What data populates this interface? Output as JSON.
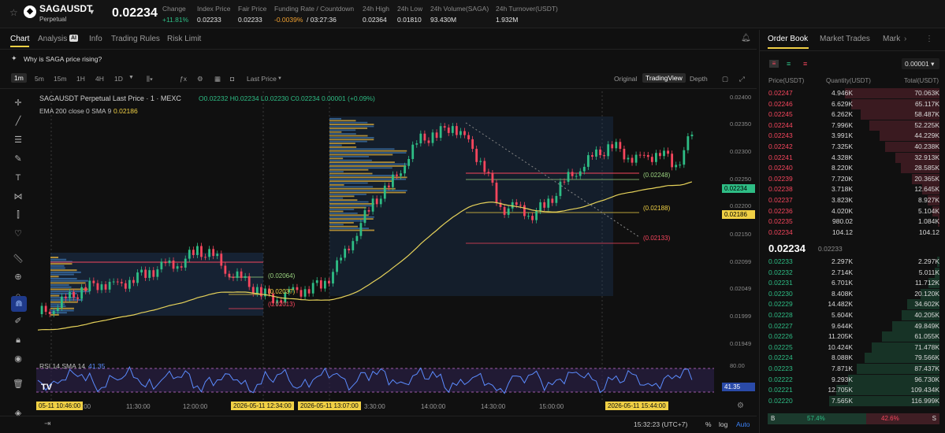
{
  "header": {
    "symbol": "SAGAUSDT",
    "subtitle": "Perpetual",
    "last_price": "0.02234",
    "stats": [
      {
        "label": "Change",
        "value": "+11.81%",
        "tone": "green"
      },
      {
        "label": "Index Price",
        "value": "0.02233",
        "tone": ""
      },
      {
        "label": "Fair Price",
        "value": "0.02233",
        "tone": ""
      },
      {
        "label": "Funding Rate / Countdown",
        "value": "-0.0039%",
        "value2": "/ 03:27:36",
        "tone": "orange"
      },
      {
        "label": "24h High",
        "value": "0.02364",
        "tone": ""
      },
      {
        "label": "24h Low",
        "value": "0.01810",
        "tone": ""
      },
      {
        "label": "24h Volume(SAGA)",
        "value": "93.430M",
        "tone": ""
      },
      {
        "label": "24h Turnover(USDT)",
        "value": "1.932M",
        "tone": ""
      }
    ]
  },
  "tabs": [
    "Chart",
    "Analysis",
    "Info",
    "Trading Rules",
    "Risk Limit"
  ],
  "analysis_badge": "AI",
  "banner": "Why is SAGA price rising?",
  "toolbar": {
    "intervals": [
      "1m",
      "5m",
      "15m",
      "1H",
      "4H",
      "1D"
    ],
    "price_type": "Last Price",
    "views": [
      "Original",
      "TradingView",
      "Depth"
    ]
  },
  "chart_info": {
    "title": "SAGAUSDT Perpetual Last Price · 1 · MEXC",
    "ohlc": "O0.02232  H0.02234  L0.02230  C0.02234  0.00001 (+0.09%)",
    "ema_label": "EMA 200 close 0 SMA 9",
    "ema_value": "0.02186",
    "rsi_label": "RSI 14 SMA 14",
    "rsi_value": "41.35",
    "rsi_badge": "41.35",
    "rsi_upper": "80.00",
    "level_labels": [
      "(0.02248)",
      "(0.02188)",
      "(0.02133)",
      "(0.02064)",
      "(0.02037)",
      "(0.02013)"
    ],
    "price_badge": "0.02234",
    "ema_badge": "0.02186"
  },
  "chart_data": {
    "type": "line",
    "y_ticks": [
      "0.02400",
      "0.02350",
      "0.02300",
      "0.02250",
      "0.02200",
      "0.02150",
      "0.02099",
      "0.02049",
      "0.01999",
      "0.01949"
    ],
    "x_ticks": [
      "11:30:00",
      "12:00:00",
      "3:30:00",
      "14:00:00",
      "14:30:00",
      "15:00:00"
    ],
    "highlighted_times": [
      "05-11  10:46:00",
      "2026-05-11  12:34:00",
      "2026-05-11  13:07:00",
      "2026-05-11  15:44:00"
    ],
    "ylim": [
      0.0193,
      0.0241
    ],
    "close": [
      0.02,
      0.02015,
      0.0203,
      0.0205,
      0.0206,
      0.0205,
      0.0207,
      0.0208,
      0.0209,
      0.021,
      0.0212,
      0.0211,
      0.0208,
      0.0206,
      0.0204,
      0.0203,
      0.0204,
      0.0205,
      0.0206,
      0.021,
      0.0216,
      0.0221,
      0.0224,
      0.0229,
      0.0233,
      0.0234,
      0.0236,
      0.0232,
      0.0228,
      0.022,
      0.022,
      0.0219,
      0.0221,
      0.0225,
      0.0228,
      0.023,
      0.0232,
      0.023,
      0.0229,
      0.0231,
      0.0228,
      0.0234
    ]
  },
  "footer": {
    "time": "15:32:23 (UTC+7)",
    "percent": "%",
    "log": "log",
    "auto": "Auto"
  },
  "orderbook": {
    "tabs": [
      "Order Book",
      "Market Trades",
      "Mark"
    ],
    "precision": "0.00001",
    "columns": [
      "Price(USDT)",
      "Quantity(USDT)",
      "Total(USDT)"
    ],
    "asks": [
      [
        "0.02247",
        "4.946K",
        "70.063K"
      ],
      [
        "0.02246",
        "6.629K",
        "65.117K"
      ],
      [
        "0.02245",
        "6.262K",
        "58.487K"
      ],
      [
        "0.02244",
        "7.996K",
        "52.225K"
      ],
      [
        "0.02243",
        "3.991K",
        "44.229K"
      ],
      [
        "0.02242",
        "7.325K",
        "40.238K"
      ],
      [
        "0.02241",
        "4.328K",
        "32.913K"
      ],
      [
        "0.02240",
        "8.220K",
        "28.585K"
      ],
      [
        "0.02239",
        "7.720K",
        "20.365K"
      ],
      [
        "0.02238",
        "3.718K",
        "12.645K"
      ],
      [
        "0.02237",
        "3.823K",
        "8.927K"
      ],
      [
        "0.02236",
        "4.020K",
        "5.104K"
      ],
      [
        "0.02235",
        "980.02",
        "1.084K"
      ],
      [
        "0.02234",
        "104.12",
        "104.12"
      ]
    ],
    "ask_totals": [
      70.063,
      65.117,
      58.487,
      52.225,
      44.229,
      40.238,
      32.913,
      28.585,
      20.365,
      12.645,
      8.927,
      5.104,
      1.084,
      0.104
    ],
    "mid_price": "0.02234",
    "mid_mark": "0.02233",
    "bids": [
      [
        "0.02233",
        "2.297K",
        "2.297K"
      ],
      [
        "0.02232",
        "2.714K",
        "5.011K"
      ],
      [
        "0.02231",
        "6.701K",
        "11.712K"
      ],
      [
        "0.02230",
        "8.408K",
        "20.120K"
      ],
      [
        "0.02229",
        "14.482K",
        "34.602K"
      ],
      [
        "0.02228",
        "5.604K",
        "40.205K"
      ],
      [
        "0.02227",
        "9.644K",
        "49.849K"
      ],
      [
        "0.02226",
        "11.205K",
        "61.055K"
      ],
      [
        "0.02225",
        "10.424K",
        "71.478K"
      ],
      [
        "0.02224",
        "8.088K",
        "79.566K"
      ],
      [
        "0.02223",
        "7.871K",
        "87.437K"
      ],
      [
        "0.02222",
        "9.293K",
        "96.730K"
      ],
      [
        "0.02221",
        "12.705K",
        "109.434K"
      ],
      [
        "0.02220",
        "7.565K",
        "116.999K"
      ]
    ],
    "bid_totals": [
      2.297,
      5.011,
      11.712,
      20.12,
      34.602,
      40.205,
      49.849,
      61.055,
      71.478,
      79.566,
      87.437,
      96.73,
      109.434,
      116.999
    ],
    "buy_label": "B",
    "buy_pct": "57.4%",
    "sell_pct": "42.6%",
    "sell_label": "S",
    "buy_ratio": 0.574
  }
}
